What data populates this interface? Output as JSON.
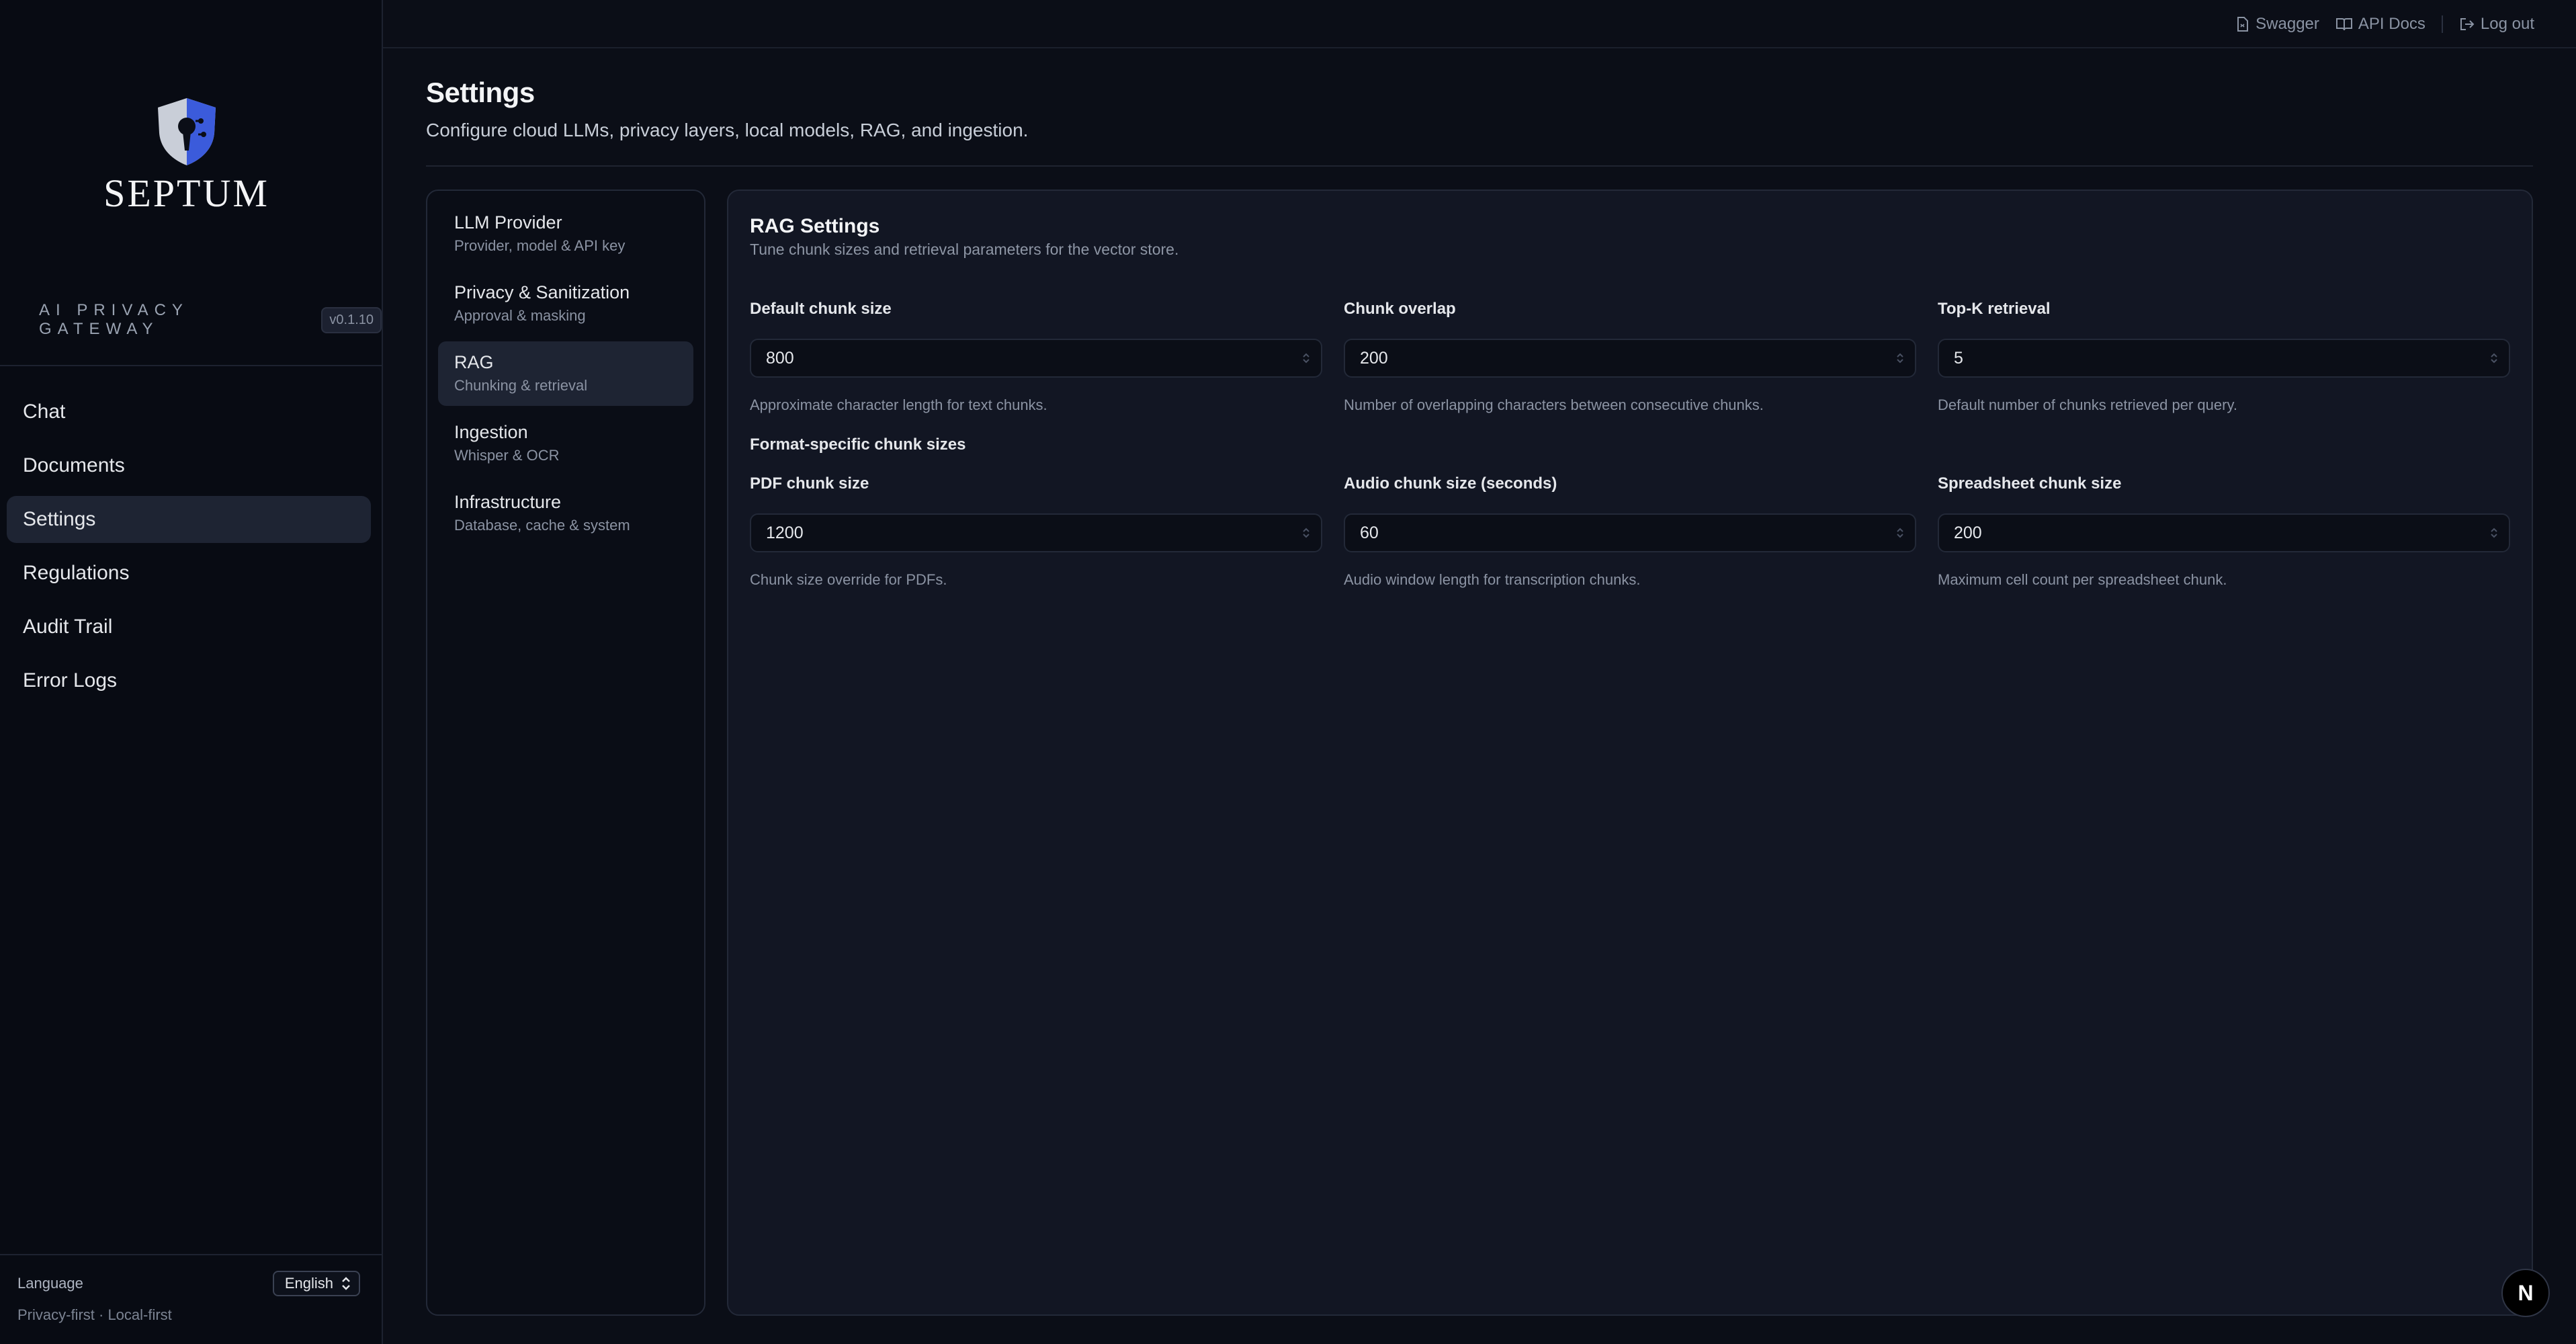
{
  "app": {
    "logo_text": "SEPTUM",
    "tagline": "AI PRIVACY GATEWAY",
    "version": "v0.1.10"
  },
  "sidebar": {
    "items": [
      {
        "label": "Chat",
        "active": false
      },
      {
        "label": "Documents",
        "active": false
      },
      {
        "label": "Settings",
        "active": true
      },
      {
        "label": "Regulations",
        "active": false
      },
      {
        "label": "Audit Trail",
        "active": false
      },
      {
        "label": "Error Logs",
        "active": false
      }
    ],
    "language_label": "Language",
    "language_value": "English",
    "footer": "Privacy-first · Local-first"
  },
  "topbar": {
    "swagger": "Swagger",
    "api_docs": "API Docs",
    "logout": "Log out"
  },
  "page": {
    "title": "Settings",
    "subtitle": "Configure cloud LLMs, privacy layers, local models, RAG, and ingestion."
  },
  "settings_nav": [
    {
      "title": "LLM Provider",
      "subtitle": "Provider, model & API key",
      "active": false
    },
    {
      "title": "Privacy & Sanitization",
      "subtitle": "Approval & masking",
      "active": false
    },
    {
      "title": "RAG",
      "subtitle": "Chunking & retrieval",
      "active": true
    },
    {
      "title": "Ingestion",
      "subtitle": "Whisper & OCR",
      "active": false
    },
    {
      "title": "Infrastructure",
      "subtitle": "Database, cache & system",
      "active": false
    }
  ],
  "rag": {
    "title": "RAG Settings",
    "subtitle": "Tune chunk sizes and retrieval parameters for the vector store.",
    "section_title": "Format-specific chunk sizes",
    "fields": [
      {
        "label": "Default chunk size",
        "value": "800",
        "help": "Approximate character length for text chunks."
      },
      {
        "label": "Chunk overlap",
        "value": "200",
        "help": "Number of overlapping characters between consecutive chunks."
      },
      {
        "label": "Top-K retrieval",
        "value": "5",
        "help": "Default number of chunks retrieved per query."
      },
      {
        "label": "PDF chunk size",
        "value": "1200",
        "help": "Chunk size override for PDFs."
      },
      {
        "label": "Audio chunk size (seconds)",
        "value": "60",
        "help": "Audio window length for transcription chunks."
      },
      {
        "label": "Spreadsheet chunk size",
        "value": "200",
        "help": "Maximum cell count per spreadsheet chunk."
      }
    ]
  },
  "fab": {
    "label": "N"
  },
  "colors": {
    "background": "#0b0e17",
    "panel": "#121623",
    "active": "#1e2433",
    "accent_blue": "#3b5bdb"
  },
  "icons": {
    "swagger": "file-icon",
    "api_docs": "book-icon",
    "logout": "logout-icon",
    "language_select": "chevron-updown-icon",
    "stepper": "stepper-icon"
  }
}
